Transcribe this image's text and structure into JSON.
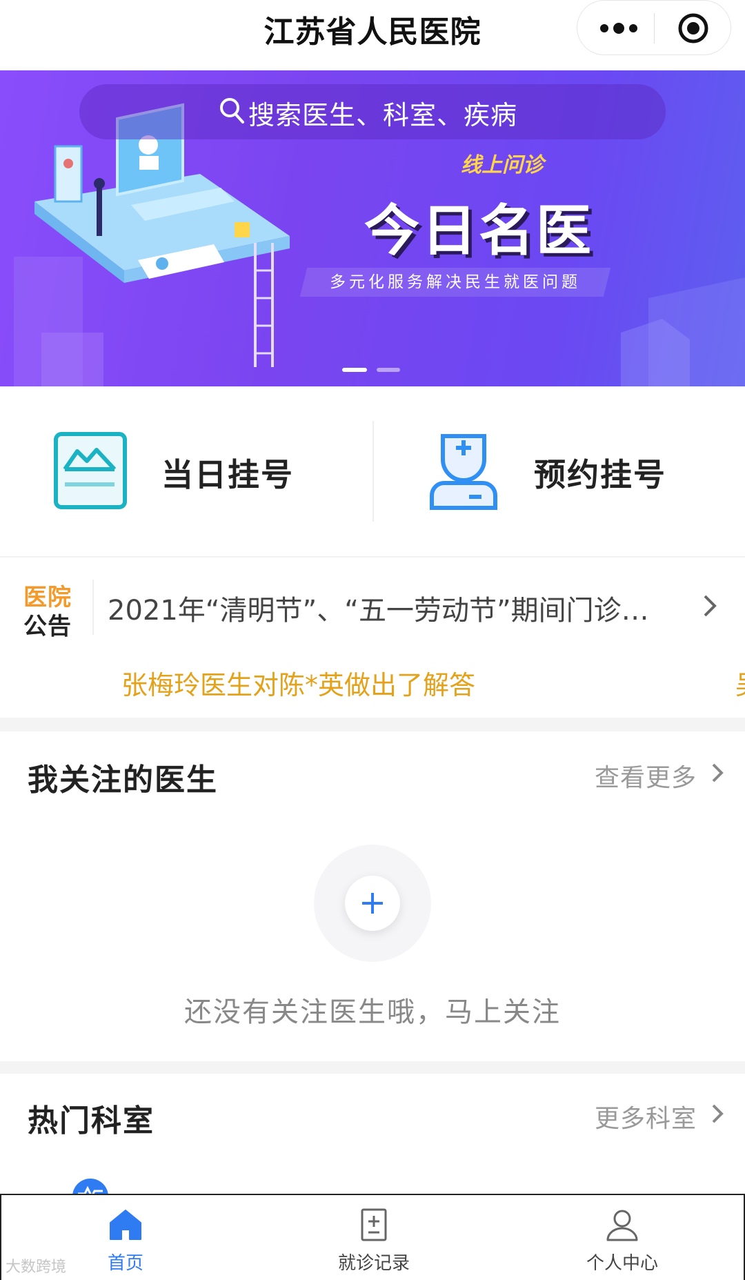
{
  "header": {
    "title": "江苏省人民医院",
    "menu_icon": "more-dots-icon",
    "close_icon": "target-close-icon"
  },
  "banner": {
    "search_placeholder": "搜索医生、科室、疾病",
    "tagline": "线上问诊",
    "headline": "今日名医",
    "subtext": "多元化服务解决民生就医问题",
    "active_slide": 1,
    "slide_count": 2
  },
  "registration": {
    "same_day": {
      "label": "当日挂号",
      "icon": "same-day-register-icon"
    },
    "appointment": {
      "label": "预约挂号",
      "icon": "doctor-appointment-icon"
    }
  },
  "notice": {
    "badge_line1": "医院",
    "badge_line2": "公告",
    "text": "2021年“清明节”、“五一劳动节”期间门诊…"
  },
  "ticker": {
    "message": "张梅玲医生对陈*英做出了解答",
    "message_next": "吴"
  },
  "followed_doctors": {
    "title": "我关注的医生",
    "more_label": "查看更多",
    "empty_text": "还没有关注医生哦，马上关注"
  },
  "hot_departments": {
    "title": "热门科室",
    "more_label": "更多科室"
  },
  "tabbar": {
    "tabs": [
      {
        "label": "首页",
        "icon": "home-icon",
        "active": true
      },
      {
        "label": "就诊记录",
        "icon": "medical-record-icon",
        "active": false
      },
      {
        "label": "个人中心",
        "icon": "user-icon",
        "active": false
      }
    ]
  },
  "colors": {
    "accent": "#2f7cf2",
    "banner_purple": "#7a45f0",
    "ticker_orange": "#e3a21a",
    "badge_orange": "#f39a2a",
    "teal": "#1bb3c4"
  },
  "watermark": "大数跨境"
}
